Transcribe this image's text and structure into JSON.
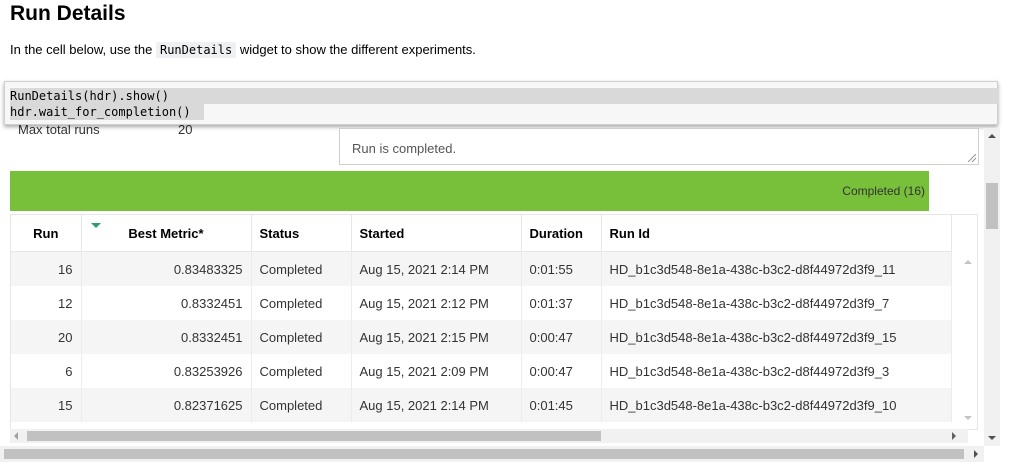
{
  "markdown": {
    "title": "Run Details",
    "instruction_before": "In the cell below, use the ",
    "instruction_code": "RunDetails",
    "instruction_after": " widget to show the different experiments."
  },
  "code_cell": {
    "line1": "RunDetails(hdr).show()",
    "line2": "hdr.wait_for_completion()"
  },
  "output": {
    "max_runs_label": "Max total runs",
    "max_runs_value": "20",
    "status_text": "Run is completed.",
    "progress_label": "Completed (16)",
    "progress_fraction": 1.0,
    "progress_color": "#78bf3a"
  },
  "table": {
    "columns": [
      "Run",
      "Best Metric*",
      "Status",
      "Started",
      "Duration",
      "Run Id"
    ],
    "rows": [
      [
        "16",
        "0.83483325",
        "Completed",
        "Aug 15, 2021 2:14 PM",
        "0:01:55",
        "HD_b1c3d548-8e1a-438c-b3c2-d8f44972d3f9_11"
      ],
      [
        "12",
        "0.8332451",
        "Completed",
        "Aug 15, 2021 2:12 PM",
        "0:01:37",
        "HD_b1c3d548-8e1a-438c-b3c2-d8f44972d3f9_7"
      ],
      [
        "20",
        "0.8332451",
        "Completed",
        "Aug 15, 2021 2:15 PM",
        "0:00:47",
        "HD_b1c3d548-8e1a-438c-b3c2-d8f44972d3f9_15"
      ],
      [
        "6",
        "0.83253926",
        "Completed",
        "Aug 15, 2021 2:09 PM",
        "0:00:47",
        "HD_b1c3d548-8e1a-438c-b3c2-d8f44972d3f9_3"
      ],
      [
        "15",
        "0.82371625",
        "Completed",
        "Aug 15, 2021 2:14 PM",
        "0:01:45",
        "HD_b1c3d548-8e1a-438c-b3c2-d8f44972d3f9_10"
      ]
    ],
    "sort_icon": "sort-descending-icon",
    "sort_color": "#2e9c7a"
  }
}
